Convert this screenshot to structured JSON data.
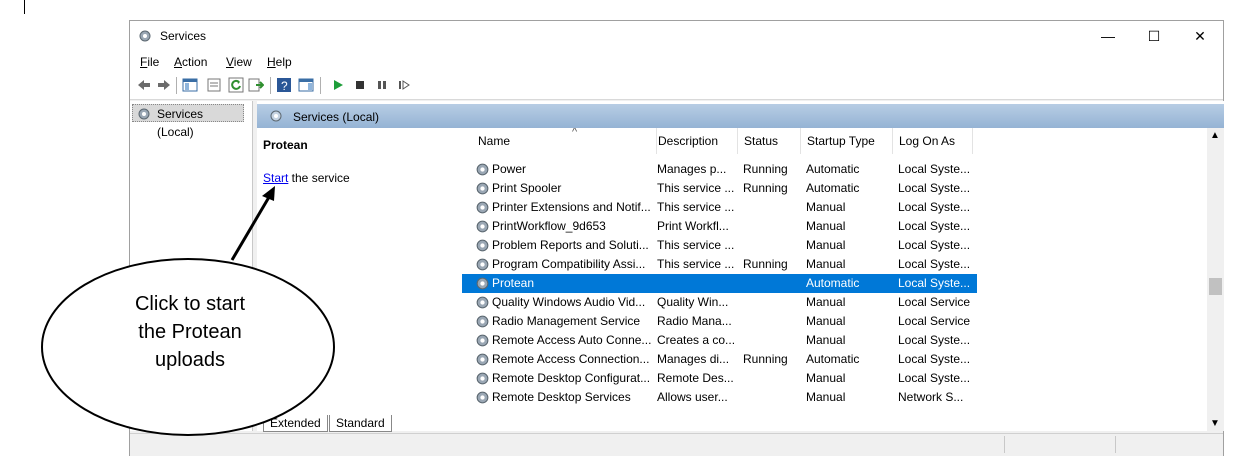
{
  "window": {
    "title": "Services"
  },
  "window_controls": {
    "minimize": "—",
    "maximize": "☐",
    "close": "✕"
  },
  "menu": [
    {
      "underline": "F",
      "rest": "ile"
    },
    {
      "underline": "A",
      "rest": "ction"
    },
    {
      "underline": "V",
      "rest": "iew"
    },
    {
      "underline": "H",
      "rest": "elp"
    }
  ],
  "tree": {
    "item": "Services (Local)"
  },
  "pane": {
    "header": "Services (Local)",
    "selected_service": "Protean",
    "start_link": "Start",
    "start_suffix": " the service"
  },
  "columns": [
    "Name",
    "Description",
    "Status",
    "Startup Type",
    "Log On As"
  ],
  "rows": [
    {
      "name": "Power",
      "desc": "Manages p...",
      "status": "Running",
      "startup": "Automatic",
      "logon": "Local Syste..."
    },
    {
      "name": "Print Spooler",
      "desc": "This service ...",
      "status": "Running",
      "startup": "Automatic",
      "logon": "Local Syste..."
    },
    {
      "name": "Printer Extensions and Notif...",
      "desc": "This service ...",
      "status": "",
      "startup": "Manual",
      "logon": "Local Syste..."
    },
    {
      "name": "PrintWorkflow_9d653",
      "desc": "Print Workfl...",
      "status": "",
      "startup": "Manual",
      "logon": "Local Syste..."
    },
    {
      "name": "Problem Reports and Soluti...",
      "desc": "This service ...",
      "status": "",
      "startup": "Manual",
      "logon": "Local Syste..."
    },
    {
      "name": "Program Compatibility Assi...",
      "desc": "This service ...",
      "status": "Running",
      "startup": "Manual",
      "logon": "Local Syste..."
    },
    {
      "name": "Protean",
      "desc": "",
      "status": "",
      "startup": "Automatic",
      "logon": "Local Syste...",
      "selected": true
    },
    {
      "name": "Quality Windows Audio Vid...",
      "desc": "Quality Win...",
      "status": "",
      "startup": "Manual",
      "logon": "Local Service"
    },
    {
      "name": "Radio Management Service",
      "desc": "Radio Mana...",
      "status": "",
      "startup": "Manual",
      "logon": "Local Service"
    },
    {
      "name": "Remote Access Auto Conne...",
      "desc": "Creates a co...",
      "status": "",
      "startup": "Manual",
      "logon": "Local Syste..."
    },
    {
      "name": "Remote Access Connection...",
      "desc": "Manages di...",
      "status": "Running",
      "startup": "Automatic",
      "logon": "Local Syste..."
    },
    {
      "name": "Remote Desktop Configurat...",
      "desc": "Remote Des...",
      "status": "",
      "startup": "Manual",
      "logon": "Local Syste..."
    },
    {
      "name": "Remote Desktop Services",
      "desc": "Allows user...",
      "status": "",
      "startup": "Manual",
      "logon": "Network S..."
    }
  ],
  "tabs": [
    "Extended",
    "Standard"
  ],
  "callout": {
    "lines": [
      "Click to start",
      "the Protean",
      "uploads"
    ]
  },
  "colors": {
    "selection": "#0078d7",
    "pane_header": "#a8c2de",
    "link": "#0000ee"
  }
}
